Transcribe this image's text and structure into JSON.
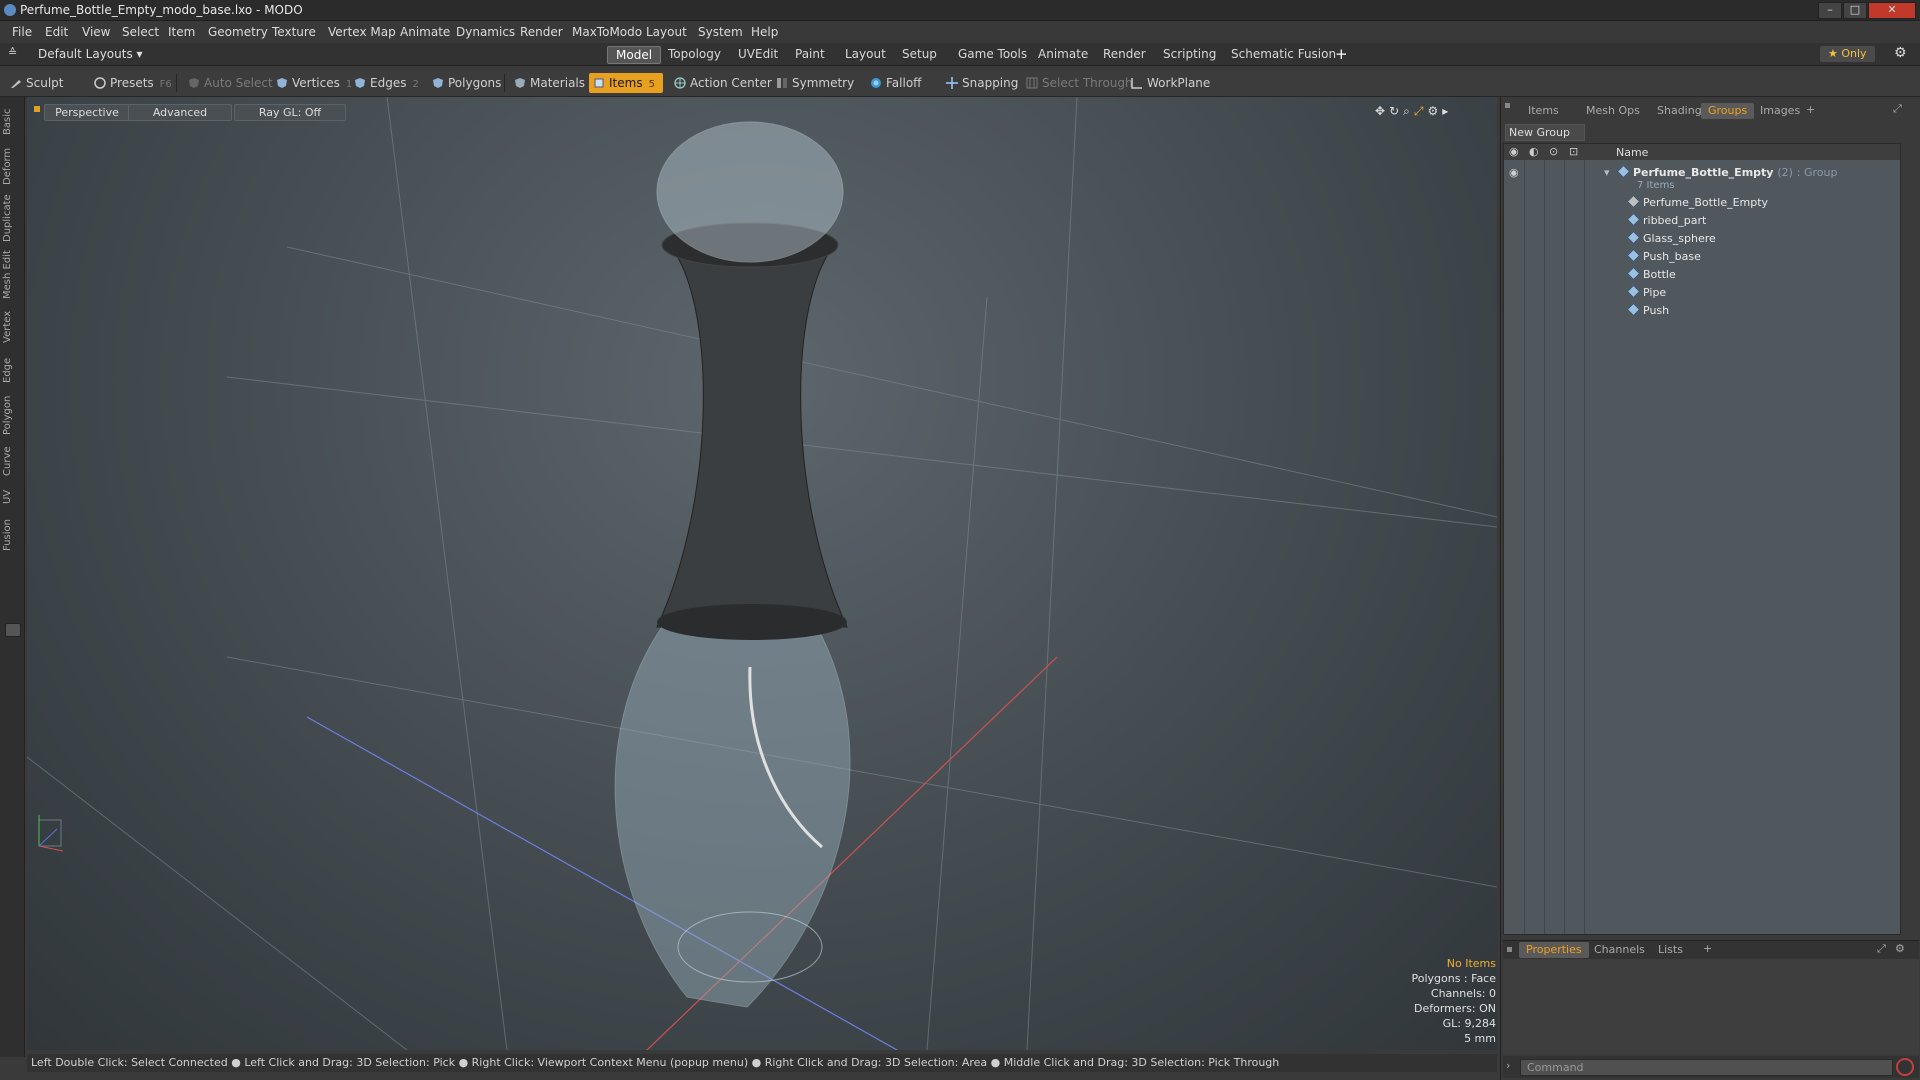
{
  "window": {
    "title": "Perfume_Bottle_Empty_modo_base.lxo - MODO",
    "min": "–",
    "max": "□",
    "close": "✕"
  },
  "menu": [
    "File",
    "Edit",
    "View",
    "Select",
    "Item",
    "Geometry",
    "Texture",
    "Vertex Map",
    "Animate",
    "Dynamics",
    "Render",
    "MaxToModo",
    "Layout",
    "System",
    "Help"
  ],
  "layout_selector": "Default Layouts ▾",
  "layout_tabs": [
    "Model",
    "Topology",
    "UVEdit",
    "Paint",
    "Layout",
    "Setup",
    "Game Tools",
    "Animate",
    "Render",
    "Scripting",
    "Schematic Fusion"
  ],
  "layout_tab_add": "+",
  "only_toggle": "★ Only",
  "toolbar": {
    "sculpt": "Sculpt",
    "presets": "Presets",
    "presets_key": "F6",
    "auto_select": "Auto Select",
    "vertices": "Vertices",
    "vertices_count": "1",
    "edges": "Edges",
    "edges_count": "2",
    "polygons": "Polygons",
    "materials": "Materials",
    "items": "Items",
    "items_count": "5",
    "action_center": "Action Center",
    "symmetry": "Symmetry",
    "falloff": "Falloff",
    "snapping": "Snapping",
    "select_through": "Select Through",
    "workplane": "WorkPlane"
  },
  "side_tabs": [
    "Basic",
    "Deform",
    "Duplicate",
    "Mesh Edit",
    "Vertex",
    "Edge",
    "Polygon",
    "Curve",
    "UV",
    "Fusion"
  ],
  "viewport": {
    "view": "Perspective",
    "shading": "Advanced",
    "raygl": "Ray GL: Off",
    "info": {
      "selection": "No Items",
      "polygons": "Polygons : Face",
      "channels": "Channels: 0",
      "deformers": "Deformers: ON",
      "gl": "GL: 9,284",
      "unit": "5 mm"
    }
  },
  "status_bar": "Left Double Click: Select Connected ● Left Click and Drag: 3D Selection: Pick ● Right Click: Viewport Context Menu (popup menu) ● Right Click and Drag: 3D Selection: Area ● Middle Click and Drag: 3D Selection: Pick Through",
  "right_panel": {
    "tabs": [
      "Items",
      "Mesh Ops",
      "Shading",
      "Groups",
      "Images"
    ],
    "active_tab": "Groups",
    "new_group": "New Group",
    "column_name": "Name",
    "group": {
      "name": "Perfume_Bottle_Empty",
      "count": "(2)",
      "type": ": Group",
      "items_label": "7 Items"
    },
    "items": [
      "Perfume_Bottle_Empty",
      "ribbed_part",
      "Glass_sphere",
      "Push_base",
      "Bottle",
      "Pipe",
      "Push"
    ],
    "bottom_tabs": [
      "Properties",
      "Channels",
      "Lists"
    ],
    "bottom_active": "Properties",
    "command_placeholder": "Command"
  },
  "colors": {
    "accent": "#f0a020",
    "viewport_bg": "#4c555a",
    "list_bg": "#50575d"
  }
}
